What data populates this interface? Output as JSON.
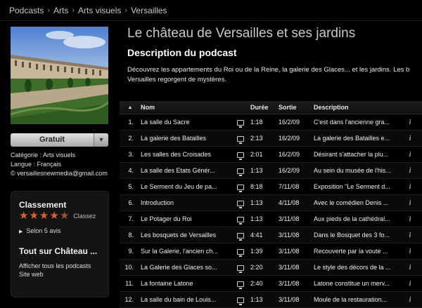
{
  "breadcrumb": [
    "Podcasts",
    "Arts",
    "Arts visuels",
    "Versailles"
  ],
  "podcast": {
    "title": "Le château de Versailles et ses jardins",
    "description_heading": "Description du podcast",
    "description_line1": "Découvrez les appartements du Roi ou de la Reine, la galerie des Glaces... et les jardins. Les b",
    "description_line2": "Versailles regorgent de mystères."
  },
  "sidebar": {
    "price_button": "Gratuit",
    "category": "Catégorie : Arts visuels",
    "language": "Langue : Français",
    "copyright": "© versaillesnewmedia@gmail.com",
    "rating_heading": "Classement",
    "rate_label": "Classez",
    "stars": 4.5,
    "reviews": "Selon 5 avis",
    "all_about": "Tout sur Château ...",
    "show_all": "Afficher tous les podcasts",
    "website": "Site web"
  },
  "table": {
    "headers": {
      "name": "Nom",
      "duration": "Durée",
      "date": "Sortie",
      "description": "Description"
    },
    "rows": [
      {
        "num": "1.",
        "name": "La salle du Sacre",
        "duration": "1:18",
        "date": "16/2/09",
        "desc": "C'est dans l'ancienne gra..."
      },
      {
        "num": "2.",
        "name": "La galerie des Batailles",
        "duration": "2:13",
        "date": "16/2/09",
        "desc": "La galerie des Batailles e..."
      },
      {
        "num": "3.",
        "name": "Les salles des Croisades",
        "duration": "2:01",
        "date": "16/2/09",
        "desc": "Désirant s'attacher la plu..."
      },
      {
        "num": "4.",
        "name": "La salle des Etats Génér...",
        "duration": "1:13",
        "date": "16/2/09",
        "desc": "Au sein du musée de l'his..."
      },
      {
        "num": "5.",
        "name": "Le Serment du Jeu de pa...",
        "duration": "8:18",
        "date": "7/11/08",
        "desc": "Exposition \"Le Serment d..."
      },
      {
        "num": "6.",
        "name": "Introduction",
        "duration": "1:13",
        "date": "4/11/08",
        "desc": "Avec le comédien Denis ..."
      },
      {
        "num": "7.",
        "name": "Le Potager du Roi",
        "duration": "1:13",
        "date": "3/11/08",
        "desc": "Aux pieds de la cathédral..."
      },
      {
        "num": "8.",
        "name": "Les bosquets de Versailles",
        "duration": "4:41",
        "date": "3/11/08",
        "desc": "Dans le Bosquet des 3 fo..."
      },
      {
        "num": "9.",
        "name": "Sur la Galerie, l'ancien ch...",
        "duration": "1:39",
        "date": "3/11/08",
        "desc": "Recouverte par la voute ..."
      },
      {
        "num": "10.",
        "name": "La Galerie des Glaces so...",
        "duration": "2:20",
        "date": "3/11/08",
        "desc": "Le style des décors de la ..."
      },
      {
        "num": "11.",
        "name": "La fontaine Latone",
        "duration": "2:40",
        "date": "3/11/08",
        "desc": "Latone constitue un merv..."
      },
      {
        "num": "12.",
        "name": "La salle du bain de Louis...",
        "duration": "1:13",
        "date": "3/11/08",
        "desc": "Moule de la restauration..."
      }
    ]
  },
  "colors": {
    "accent_star": "#d3633a",
    "background": "#000000"
  }
}
